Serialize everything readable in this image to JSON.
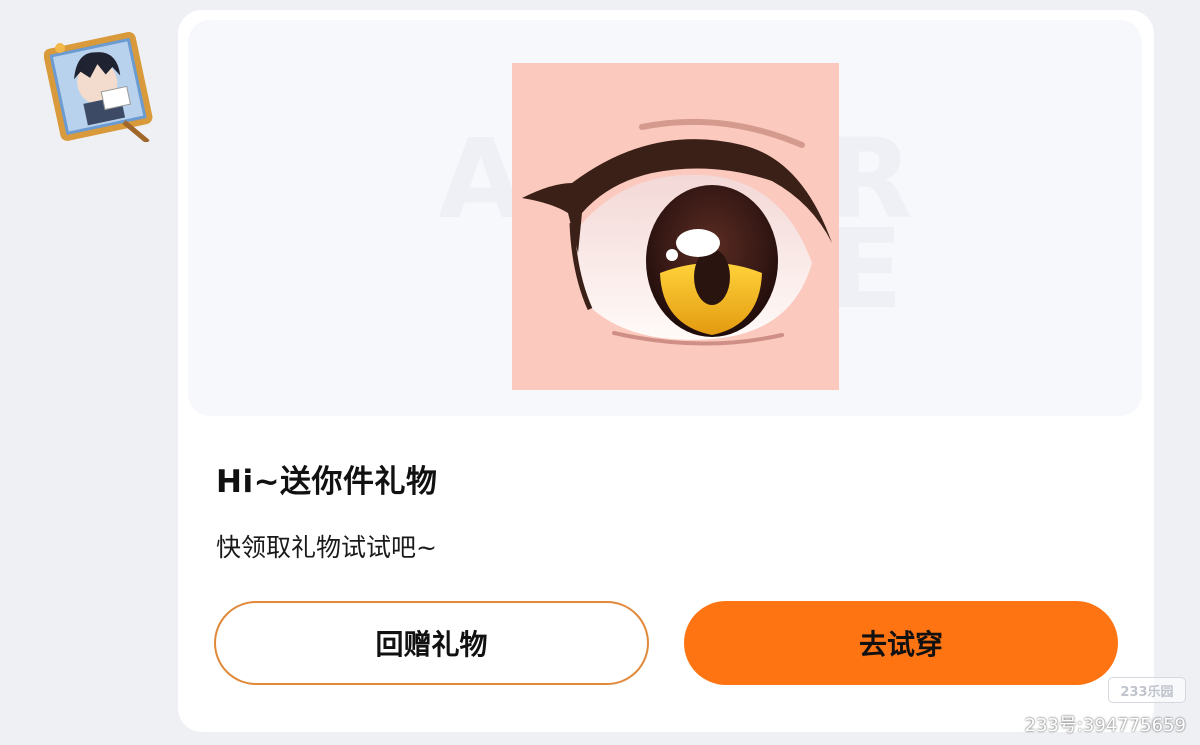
{
  "gift_card": {
    "title": "Hi~送你件礼物",
    "subtitle": "快领取礼物试试吧~",
    "return_gift_button": "回赠礼物",
    "try_on_button": "去试穿"
  },
  "preview": {
    "item_icon": "anime-eye-icon",
    "watermark_text": "AE"
  },
  "footer": {
    "logo_text": "233乐园",
    "uid_text": "233号:394775659"
  },
  "colors": {
    "accent": "#ff7412",
    "outline": "#e0893a",
    "card_bg": "#ffffff",
    "page_bg": "#eef0f4"
  }
}
